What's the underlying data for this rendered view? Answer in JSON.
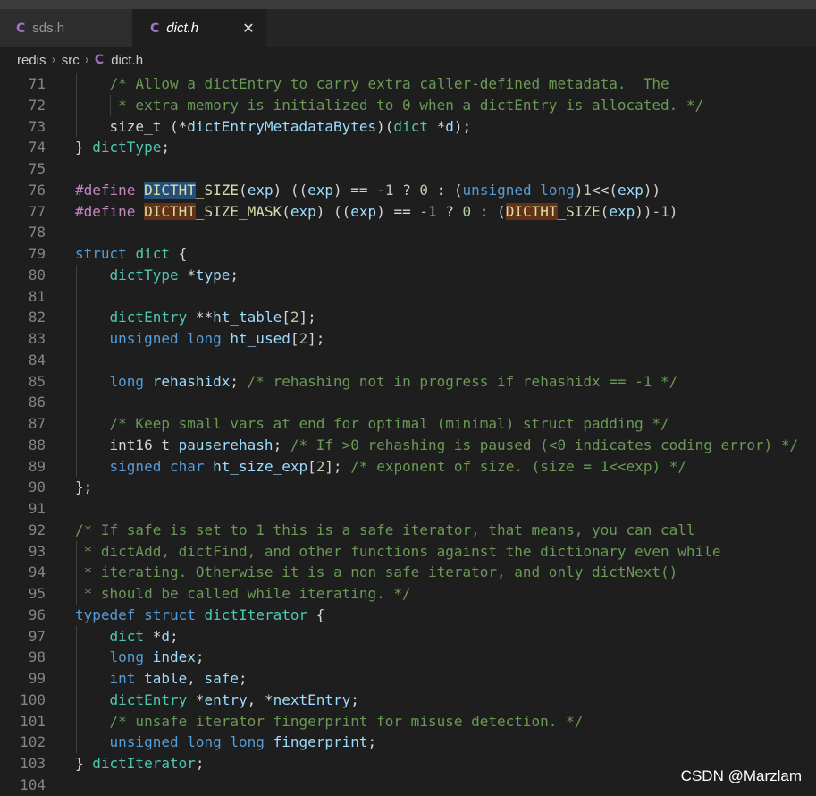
{
  "tabs": [
    {
      "label": "sds.h",
      "icon": "c-file-icon",
      "icon_glyph": "C",
      "active": false
    },
    {
      "label": "dict.h",
      "icon": "c-file-icon",
      "icon_glyph": "C",
      "active": true,
      "close_glyph": "✕"
    }
  ],
  "breadcrumb": {
    "parts": [
      "redis",
      "src",
      "dict.h"
    ],
    "separator": "›",
    "file_icon_glyph": "C"
  },
  "code": {
    "line_numbers": [
      "71",
      "72",
      "73",
      "74",
      "75",
      "76",
      "77",
      "78",
      "79",
      "80",
      "81",
      "82",
      "83",
      "84",
      "85",
      "86",
      "87",
      "88",
      "89",
      "90",
      "91",
      "92",
      "93",
      "94",
      "95",
      "96",
      "97",
      "98",
      "99",
      "100",
      "101",
      "102",
      "103",
      "104"
    ],
    "lines": [
      "    /* Allow a dictEntry to carry extra caller-defined metadata.  The",
      "     * extra memory is initialized to 0 when a dictEntry is allocated. */",
      "    size_t (*dictEntryMetadataBytes)(dict *d);",
      "} dictType;",
      "",
      "#define DICTHT_SIZE(exp) ((exp) == -1 ? 0 : (unsigned long)1<<(exp))",
      "#define DICTHT_SIZE_MASK(exp) ((exp) == -1 ? 0 : (DICTHT_SIZE(exp))-1)",
      "",
      "struct dict {",
      "    dictType *type;",
      "",
      "    dictEntry **ht_table[2];",
      "    unsigned long ht_used[2];",
      "",
      "    long rehashidx; /* rehashing not in progress if rehashidx == -1 */",
      "",
      "    /* Keep small vars at end for optimal (minimal) struct padding */",
      "    int16_t pauserehash; /* If >0 rehashing is paused (<0 indicates coding error) */",
      "    signed char ht_size_exp[2]; /* exponent of size. (size = 1<<exp) */",
      "};",
      "",
      "/* If safe is set to 1 this is a safe iterator, that means, you can call",
      " * dictAdd, dictFind, and other functions against the dictionary even while",
      " * iterating. Otherwise it is a non safe iterator, and only dictNext()",
      " * should be called while iterating. */",
      "typedef struct dictIterator {",
      "    dict *d;",
      "    long index;",
      "    int table, safe;",
      "    dictEntry *entry, *nextEntry;",
      "    /* unsafe iterator fingerprint for misuse detection. */",
      "    unsigned long long fingerprint;",
      "} dictIterator;",
      ""
    ]
  },
  "watermark": "CSDN @Marzlam",
  "colors": {
    "background": "#1e1e1e",
    "keyword": "#569cd6",
    "type": "#4ec9b0",
    "function": "#dcdcaa",
    "variable": "#9cdcfe",
    "comment": "#6a9955",
    "preprocessor": "#c586c0",
    "number": "#b5cea8",
    "selection_highlight": "#264f78",
    "word_highlight": "#613214",
    "c_icon": "#a074c4"
  }
}
